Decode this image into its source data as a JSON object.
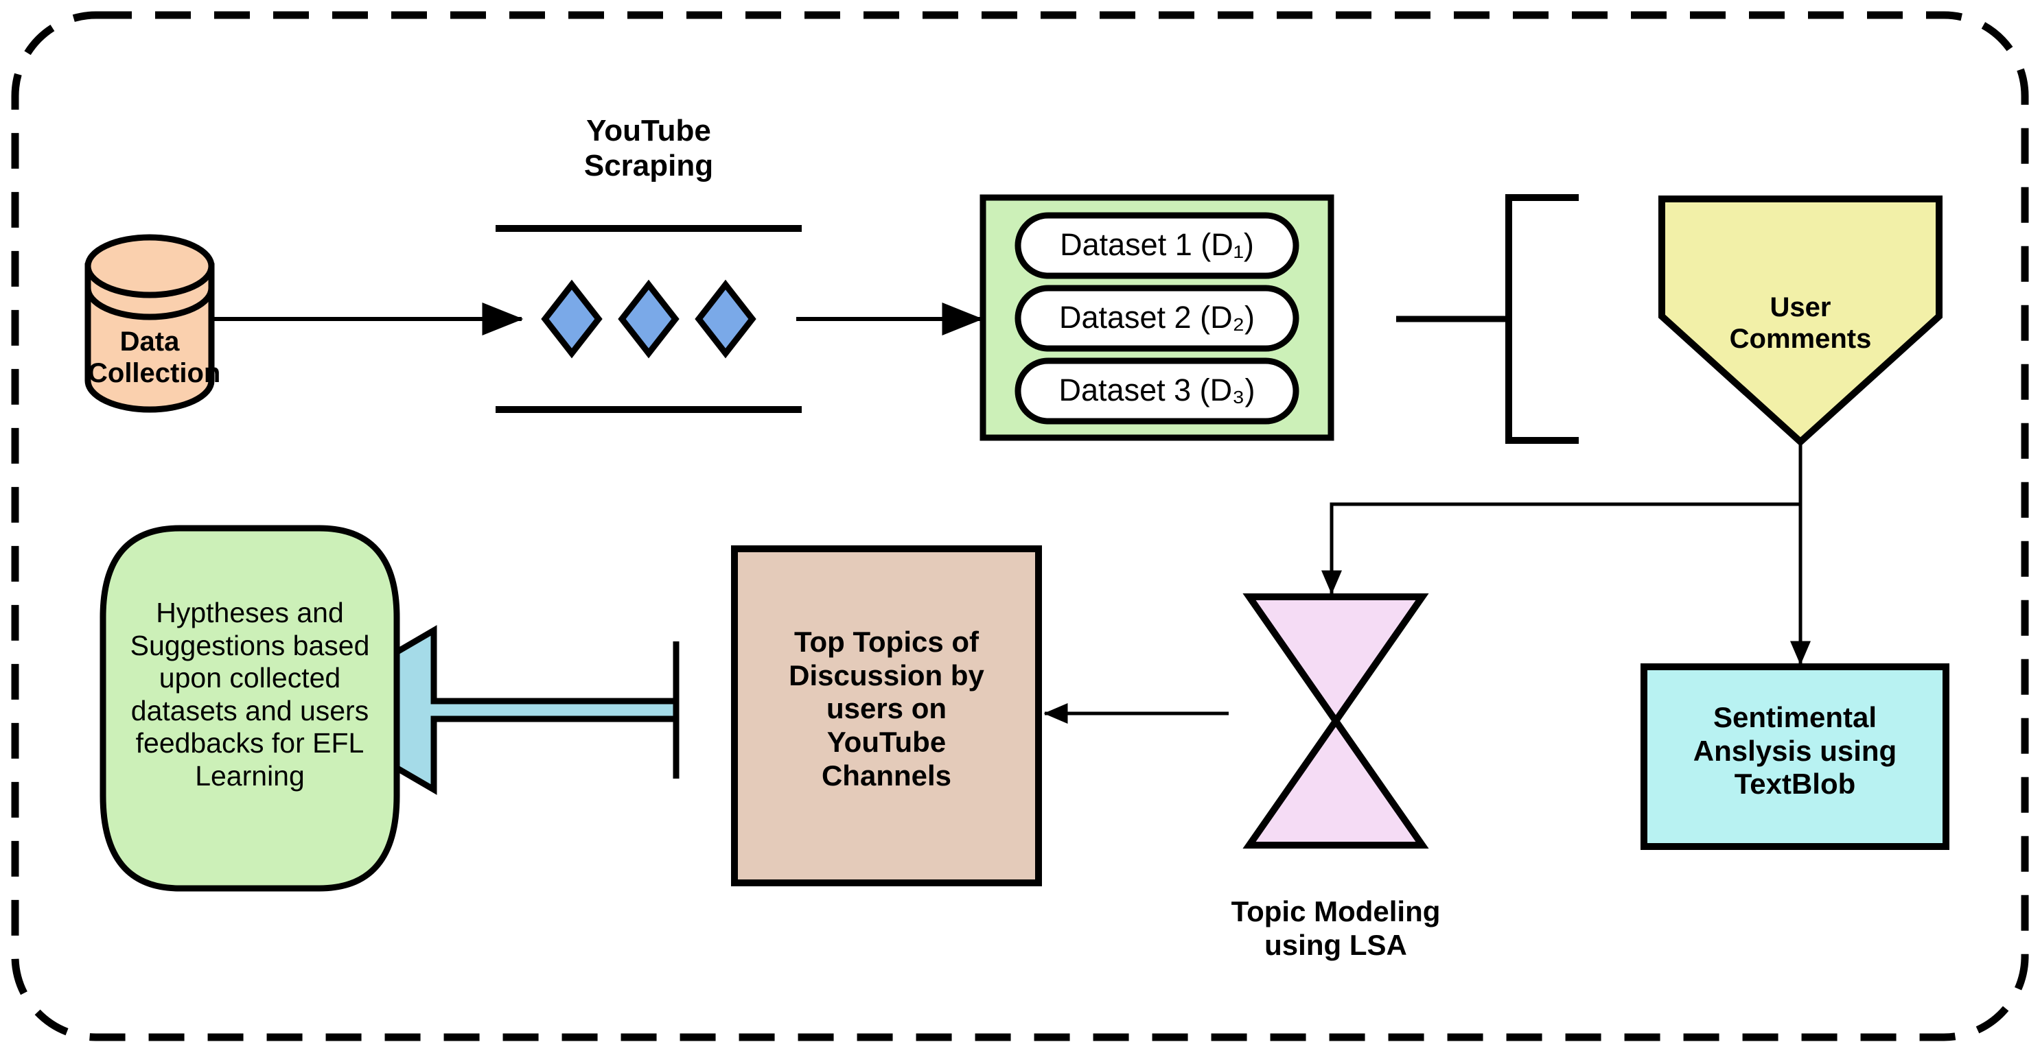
{
  "diagram": {
    "title": "Research methodology flowchart for EFL learning based on YouTube data",
    "border_style": "dashed-rounded",
    "colors": {
      "cylinder_fill": "#fad0ae",
      "dataset_group_fill": "#ccf0b8",
      "dataset_pill_fill": "#ffffff",
      "user_comments_fill": "#f2f0a8",
      "diamond_fill": "#7aa9e8",
      "hourglass_fill": "#f5dcf5",
      "topics_box_fill": "#e4cbba",
      "sentiment_box_fill": "#b8f2f2",
      "outcome_fill": "#ccf0b8",
      "big_arrow_fill": "#a5dbe8",
      "stroke": "#000000"
    }
  },
  "nodes": {
    "data_collection": {
      "label": "Data Collection",
      "shape": "cylinder"
    },
    "youtube_scraping": {
      "label": "YouTube\nScraping",
      "shape": "process-band-with-diamonds",
      "diamond_count": 3
    },
    "datasets": {
      "shape": "group-box",
      "items": [
        {
          "label": "Dataset 1 (D₁)"
        },
        {
          "label": "Dataset 2 (D₂)"
        },
        {
          "label": "Dataset 3 (D₃)"
        }
      ]
    },
    "bracket": {
      "label": "",
      "shape": "left-bracket"
    },
    "user_comments": {
      "label": "User\nComments",
      "shape": "pentagon-down"
    },
    "topic_modeling": {
      "label": "Topic Modeling\nusing LSA",
      "shape": "hourglass"
    },
    "sentiment_analysis": {
      "label": "Sentimental\nAnslysis using\nTextBlob",
      "shape": "rectangle"
    },
    "top_topics": {
      "label": "Top Topics of\nDiscussion by\nusers on\nYouTube\nChannels",
      "shape": "rectangle"
    },
    "outcome": {
      "label": "Hyptheses and\nSuggestions based\nupon collected\ndatasets and users\nfeedbacks for EFL\nLearning",
      "shape": "rounded-barrel"
    },
    "result_arrow": {
      "label": "",
      "shape": "block-arrow-left"
    }
  },
  "edges": [
    {
      "from": "data_collection",
      "to": "youtube_scraping",
      "type": "arrow-right"
    },
    {
      "from": "youtube_scraping",
      "to": "datasets",
      "type": "arrow-right"
    },
    {
      "from": "datasets",
      "to": "bracket",
      "type": "line-right"
    },
    {
      "from": "user_comments",
      "to": "topic_modeling",
      "type": "elbow-arrow-down-left"
    },
    {
      "from": "user_comments",
      "to": "sentiment_analysis",
      "type": "arrow-down"
    },
    {
      "from": "topic_modeling",
      "to": "top_topics",
      "type": "arrow-left"
    },
    {
      "from": "top_topics",
      "to": "outcome",
      "type": "block-arrow-left"
    }
  ]
}
